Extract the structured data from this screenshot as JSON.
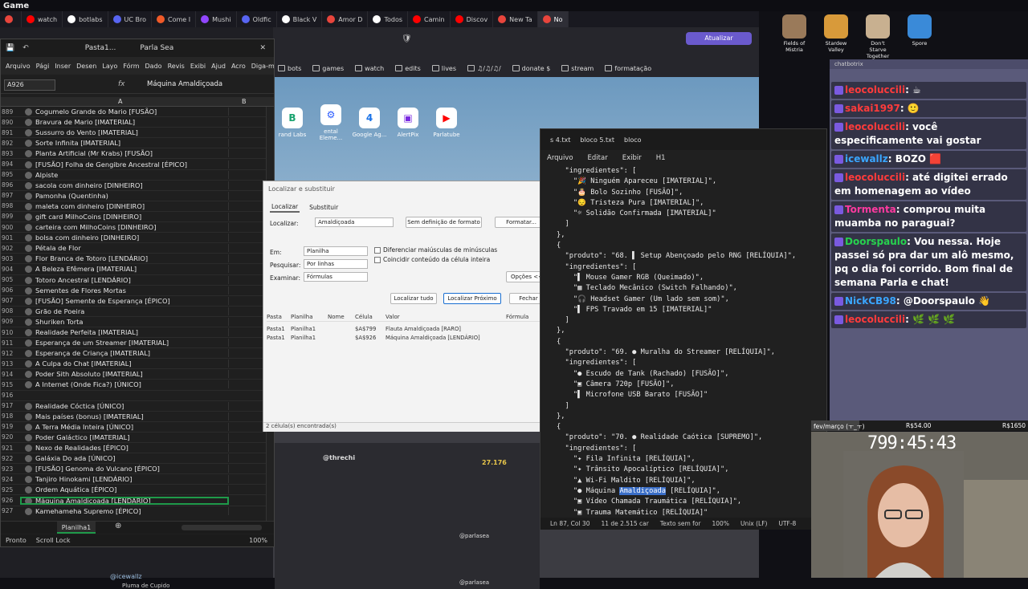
{
  "obs_title": "Game",
  "browser": {
    "tabs": [
      {
        "label": "",
        "color": "#e8453c"
      },
      {
        "label": "watch",
        "color": "#ff0000"
      },
      {
        "label": "botlabs",
        "color": "#ffffff"
      },
      {
        "label": "UC Bro",
        "color": "#5865f2"
      },
      {
        "label": "Come I",
        "color": "#f05a28"
      },
      {
        "label": "Mushi",
        "color": "#9146ff"
      },
      {
        "label": "Oldfic",
        "color": "#5865f2"
      },
      {
        "label": "Black V",
        "color": "#ffffff"
      },
      {
        "label": "Amor D",
        "color": "#e8453c"
      },
      {
        "label": "Todos",
        "color": "#ffffff"
      },
      {
        "label": "Camin",
        "color": "#ff0000"
      },
      {
        "label": "Discov",
        "color": "#ff0000"
      },
      {
        "label": "New Ta",
        "color": "#e8453c"
      },
      {
        "label": "No",
        "color": "#e8453c"
      }
    ],
    "atualizar": "Atualizar",
    "bookmarks": [
      "bots",
      "games",
      "watch",
      "edits",
      "lives",
      "♫/♫/♫/",
      "donate $",
      "stream",
      "formatação"
    ],
    "shortcuts": [
      {
        "label": "rand Labs",
        "glyph": "B",
        "color": "#1aa36f"
      },
      {
        "label": "ental Eleme...",
        "glyph": "⚙",
        "color": "#2b5cff"
      },
      {
        "label": "Google Ag...",
        "glyph": "4",
        "color": "#1a73e8"
      },
      {
        "label": "AlertPix",
        "glyph": "▣",
        "color": "#7a2ae0"
      },
      {
        "label": "Parlatube",
        "glyph": "▶",
        "color": "#ff0000"
      }
    ]
  },
  "excel": {
    "title_left": "Pasta1...",
    "title_right": "Parla Sea",
    "ribbon": [
      "Arquivo",
      "Pági",
      "Inser",
      "Desen",
      "Layo",
      "Fórm",
      "Dado",
      "Revis",
      "Exibi",
      "Ajud",
      "Acro",
      "Diga-me"
    ],
    "namebox": "A926",
    "formula": "Máquina Amaldiçoada",
    "col_a": "A",
    "col_b": "B",
    "rows": [
      {
        "n": "889",
        "v": "Cogumelo Grande do Mario [FUSÃO]"
      },
      {
        "n": "890",
        "v": "Bravura de Mario [IMATERIAL]"
      },
      {
        "n": "891",
        "v": "Sussurro do Vento [IMATERIAL]"
      },
      {
        "n": "892",
        "v": "Sorte Infinita [IMATERIAL]"
      },
      {
        "n": "893",
        "v": "Planta Artificial (Mr Krabs) [FUSÃO]"
      },
      {
        "n": "894",
        "v": "[FUSÃO] Folha de Gengibre Ancestral [ÉPICO]"
      },
      {
        "n": "895",
        "v": "Alpiste"
      },
      {
        "n": "896",
        "v": "sacola com dinheiro [DINHEIRO]"
      },
      {
        "n": "897",
        "v": "Pamonha (Quentinha)"
      },
      {
        "n": "898",
        "v": "maleta com dinheiro [DINHEIRO]"
      },
      {
        "n": "899",
        "v": "gift card MilhoCoins [DINHEIRO]"
      },
      {
        "n": "900",
        "v": "carteira com  MilhoCoins [DINHEIRO]"
      },
      {
        "n": "901",
        "v": "bolsa com dinheiro [DINHEIRO]"
      },
      {
        "n": "902",
        "v": "Pétala de Flor"
      },
      {
        "n": "903",
        "v": "Flor Branca de Totoro [LENDÁRIO]"
      },
      {
        "n": "904",
        "v": "A Beleza Efêmera [IMATERIAL]"
      },
      {
        "n": "905",
        "v": "Totoro Ancestral [LENDÁRIO]"
      },
      {
        "n": "906",
        "v": "Sementes de Flores Mortas"
      },
      {
        "n": "907",
        "v": "[FUSÃO] Semente de Esperança [ÉPICO]"
      },
      {
        "n": "908",
        "v": "Grão de Poeira"
      },
      {
        "n": "909",
        "v": "Shuriken Torta"
      },
      {
        "n": "910",
        "v": "Realidade Perfeita [IMATERIAL]"
      },
      {
        "n": "911",
        "v": "Esperança de um Streamer [IMATERIAL]"
      },
      {
        "n": "912",
        "v": "Esperança de Criança [IMATERIAL]"
      },
      {
        "n": "913",
        "v": "A Culpa do Chat [IMATERIAL]"
      },
      {
        "n": "914",
        "v": "Poder Sith Absoluto [IMATERIAL]"
      },
      {
        "n": "915",
        "v": "A Internet (Onde Fica?) [ÚNICO]"
      },
      {
        "n": "916",
        "v": ""
      },
      {
        "n": "917",
        "v": "Realidade Cóctica [ÚNICO]"
      },
      {
        "n": "918",
        "v": "Mais  países (bonus) [IMATERIAL]"
      },
      {
        "n": "919",
        "v": "A Terra Média Inteira [ÚNICO]"
      },
      {
        "n": "920",
        "v": "Poder Galáctico [IMATERIAL]"
      },
      {
        "n": "921",
        "v": "Nexo de Realidades [ÉPICO]"
      },
      {
        "n": "922",
        "v": "Galáxia Do ada [ÚNICO]"
      },
      {
        "n": "923",
        "v": "[FUSÃO] Genoma do Vulcano [ÉPICO]"
      },
      {
        "n": "924",
        "v": "Tanjiro Hinokami [LENDÁRIO]"
      },
      {
        "n": "925",
        "v": "Ordem Aquática [ÉPICO]"
      },
      {
        "n": "926",
        "v": "Máquina Amaldiçoada [LENDÁRIO]"
      },
      {
        "n": "927",
        "v": "Kamehameha Supremo [ÉPICO]"
      }
    ],
    "sheet": "Planilha1",
    "status_ready": "Pronto",
    "status_scroll": "Scroll Lock",
    "zoom": "100%"
  },
  "dialog": {
    "title": "Localizar e substituir",
    "tab_find": "Localizar",
    "tab_replace": "Substituir",
    "find_label": "Localizar:",
    "find_value": "Amaldiçoada",
    "no_format": "Sem definição de formato",
    "format_btn": "Formatar...",
    "within_label": "Em:",
    "within_value": "Planilha",
    "search_label": "Pesquisar:",
    "search_value": "Por linhas",
    "lookin_label": "Examinar:",
    "lookin_value": "Fórmulas",
    "match_case": "Diferenciar maiúsculas de minúsculas",
    "match_cell": "Coincidir conteúdo da célula inteira",
    "options_btn": "Opções <<",
    "find_all": "Localizar tudo",
    "find_next": "Localizar Próximo",
    "close": "Fechar",
    "headers": [
      "Pasta",
      "Planilha",
      "Nome",
      "Célula",
      "Valor",
      "Fórmula"
    ],
    "results": [
      {
        "book": "Pasta1",
        "sheet": "Planilha1",
        "name": "",
        "cell": "$A$799",
        "value": "Flauta Amaldiçoada [RARO]"
      },
      {
        "book": "Pasta1",
        "sheet": "Planilha1",
        "name": "",
        "cell": "$A$926",
        "value": "Máquina Amaldiçoada [LENDÁRIO]"
      }
    ],
    "status": "2 célula(s) encontrada(s)"
  },
  "notepad": {
    "tabs": [
      "s 4.txt",
      "bloco 5.txt",
      "bloco"
    ],
    "menu": [
      "Arquivo",
      "Editar",
      "Exibir",
      "H1"
    ],
    "lines": [
      "  \"ingredientes\": [",
      "    \"🎉 Ninguém Apareceu [IMATERIAL]\",",
      "    \"🎂 Bolo Sozinho [FUSÃO]\",",
      "    \"😔 Tristeza Pura [IMATERIAL]\",",
      "    \"☼ Solidão Confirmada [IMATERIAL]\"",
      "  ]",
      "},",
      "{",
      "  \"produto\": \"68. ▌ Setup Abençoado pelo RNG [RELÍQUIA]\",",
      "  \"ingredientes\": [",
      "    \"▌ Mouse Gamer RGB (Queimado)\",",
      "    \"▦ Teclado Mecânico (Switch Falhando)\",",
      "    \"🎧 Headset Gamer (Um lado sem som)\",",
      "    \"▌ FPS Travado em 15 [IMATERIAL]\"",
      "  ]",
      "},",
      "{",
      "  \"produto\": \"69. ● Muralha do Streamer [RELÍQUIA]\",",
      "  \"ingredientes\": [",
      "    \"● Escudo de Tank (Rachado) [FUSÃO]\",",
      "    \"▣ Câmera 720p [FUSÃO]\",",
      "    \"▌ Microfone USB Barato [FUSÃO]\"",
      "  ]",
      "},",
      "{",
      "  \"produto\": \"70. ● Realidade Caótica [SUPREMO]\",",
      "  \"ingredientes\": [",
      "    \"✦ Fila Infinita [RELÍQUIA]\",",
      "    \"✦ Trânsito Apocalíptico [RELÍQUIA]\",",
      "    \"▲ Wi-Fi Maldito [RELÍQUIA]\","
    ],
    "hl_prefix": "    \"● Máquina ",
    "hl_word": "Amaldiçoada",
    "hl_suffix": " [RELÍQUIA]\",",
    "after_lines": [
      "    \"▣ Vídeo Chamada Traumática [RELÍQUIA]\",",
      "    \"▣ Trauma Matemático [RELÍQUIA]\"",
      "  ]",
      "}"
    ],
    "status": [
      "Ln 87, Col 30",
      "11 de 2.515 car",
      "Texto sem for",
      "100%",
      "Unix (LF)",
      "UTF-8"
    ]
  },
  "desktop_icons": [
    {
      "label": "Fields of Mistria",
      "color": "#9a7a5a"
    },
    {
      "label": "Stardew Valley",
      "color": "#d89a3a"
    },
    {
      "label": "Don't Starve Together",
      "color": "#c8b090"
    },
    {
      "label": "Spore",
      "color": "#3a8ad8"
    }
  ],
  "chat": {
    "header": "chatbotrix",
    "messages": [
      {
        "user": "leocoluccili",
        "uclass": "u-red",
        "text": ": ☕"
      },
      {
        "user": "sakai1997",
        "uclass": "u-red",
        "text": ": 🙂"
      },
      {
        "user": "leocoluccili",
        "uclass": "u-red",
        "text": ": você especificamente vai gostar"
      },
      {
        "user": "icewallz",
        "uclass": "u-blue",
        "text": ": BOZO 🟥"
      },
      {
        "user": "leocoluccili",
        "uclass": "u-red",
        "text": ": até digitei errado em homenagem ao vídeo"
      },
      {
        "user": "Tormenta",
        "uclass": "u-pink",
        "text": ": comprou muita muamba no paraguai?"
      },
      {
        "user": "Doorspaulo",
        "uclass": "u-green",
        "text": ": Vou nessa. Hoje passei só pra dar um alô mesmo, pq o dia foi corrido. Bom final de semana Parla e chat!"
      },
      {
        "user": "NickCB98",
        "uclass": "u-blue",
        "text": ": @Doorspaulo 👋"
      },
      {
        "user": "leocoluccili",
        "uclass": "u-red",
        "text": ": 🌿 🌿 🌿"
      }
    ]
  },
  "goal": {
    "label": "fev/março (ㅜ_ㅜ)",
    "current": "R$54.00",
    "target": "R$1650"
  },
  "timer": "799:45:43",
  "lower": {
    "name": "@threchi",
    "amount": "27.176",
    "tag1": "@parlasea",
    "tag2": "@parlasea",
    "tag3": "@parlasea",
    "user2": "@icewallz",
    "item": "Pluma de Cupido"
  }
}
